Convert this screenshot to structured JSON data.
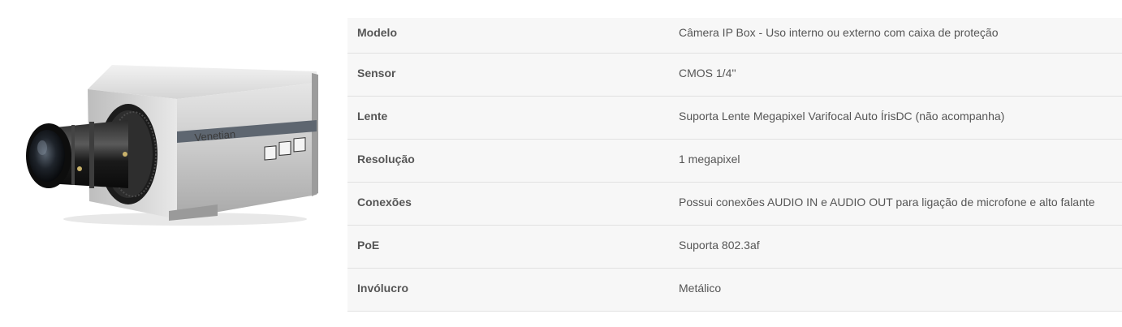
{
  "product": {
    "brand_label": "Venetian",
    "image_icon": "ip-box-camera"
  },
  "specs": {
    "rows": [
      {
        "label": "Modelo",
        "value": "Câmera IP Box - Uso interno ou externo com caixa de proteção"
      },
      {
        "label": "Sensor",
        "value": "CMOS 1/4''"
      },
      {
        "label": "Lente",
        "value": "Suporta Lente Megapixel Varifocal Auto ÍrisDC (não acompanha)"
      },
      {
        "label": "Resolução",
        "value": "1 megapixel"
      },
      {
        "label": "Conexões",
        "value": "Possui conexões AUDIO IN e AUDIO OUT para ligação de microfone e alto falante"
      },
      {
        "label": "PoE",
        "value": "Suporta 802.3af"
      },
      {
        "label": "Invólucro",
        "value": "Metálico"
      }
    ]
  },
  "colors": {
    "table_background": "#f7f7f7",
    "row_divider": "#e1e1e1",
    "text": "#555555"
  }
}
